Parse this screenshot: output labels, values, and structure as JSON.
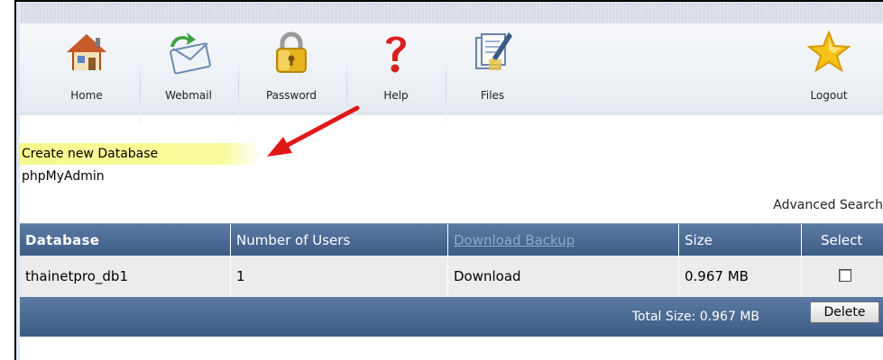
{
  "toolbar": {
    "items": [
      {
        "label": "Home",
        "icon": "home-icon"
      },
      {
        "label": "Webmail",
        "icon": "webmail-icon"
      },
      {
        "label": "Password",
        "icon": "lock-icon"
      },
      {
        "label": "Help",
        "icon": "help-icon"
      },
      {
        "label": "Files",
        "icon": "files-icon"
      },
      {
        "label": "Logout",
        "icon": "star-icon"
      }
    ]
  },
  "links": {
    "create_database": "Create new Database",
    "phpmyadmin": "phpMyAdmin",
    "advanced_search": "Advanced Search"
  },
  "table": {
    "columns": [
      "Database",
      "Number of Users",
      "Download Backup",
      "Size",
      "Select"
    ],
    "rows": [
      {
        "database": "thainetpro_db1",
        "users": "1",
        "backup": "Download",
        "size": "0.967 MB",
        "selected": false
      }
    ],
    "total_size": "Total Size: 0.967 MB",
    "delete_label": "Delete"
  },
  "colors": {
    "header_blue": "#3b5b86",
    "highlight_yellow": "#f6f98d",
    "arrow_red": "#e01818"
  }
}
